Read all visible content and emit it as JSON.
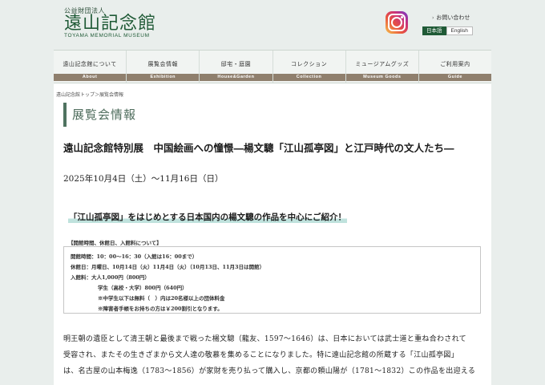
{
  "header": {
    "org": "公益財団法人",
    "name": "遠山記念館",
    "name_en": "TOYAMA MEMORIAL MUSEUM",
    "contact": "お問い合わせ",
    "lang_ja": "日本語",
    "lang_en": "English"
  },
  "nav": [
    {
      "ja": "遠山記念館について",
      "en": "About"
    },
    {
      "ja": "展覧会情報",
      "en": "Exhibition"
    },
    {
      "ja": "邸宅・庭園",
      "en": "House&Garden"
    },
    {
      "ja": "コレクション",
      "en": "Collection"
    },
    {
      "ja": "ミュージアムグッズ",
      "en": "Museum Goods"
    },
    {
      "ja": "ご利用案内",
      "en": "Guide"
    }
  ],
  "breadcrumb": "遠山記念館トップ＞展覧会情報",
  "section_title": "展覧会情報",
  "article": {
    "title": "遠山記念館特別展　中国絵画への憧憬―楊文驄「江山孤亭図」と江戸時代の文人たち―",
    "date": "2025年10月4日（土）～11月16日（日）",
    "highlight": "「江山孤亭図」をはじめとする日本国内の楊文驄の作品を中心にご紹介！",
    "hours_label": "【開館時間、休館日、入館料について】",
    "hours": [
      "開館時間：10：00～16：30（入館は16：00まで）",
      "休館日：月曜日、10月14日（火）11月4日（火）（10月13日、11月3日は開館）",
      "入館料：大人1,000円（800円）",
      "学生（高校・大学）800円（640円）",
      "※中学生以下は無料（　）内は20名様以上の団体料金",
      "※障害者手帳をお持ちの方は￥200割引となります。"
    ],
    "paragraph": [
      "明王朝の遺臣として清王朝と最後まで戦った楊文驄（龍友、1597～1646）は、日本においては武士道と重ね合わされて",
      "受容され、またその生きざまから文人達の敬慕を集めることになりました。特に遠山記念館の所蔵する「江山孤亭図」",
      "は、名古屋の山本梅逸（1783～1856）が家財を売り払って購入し、京都の頼山陽が（1781～1832）この作品を出迎える"
    ]
  }
}
